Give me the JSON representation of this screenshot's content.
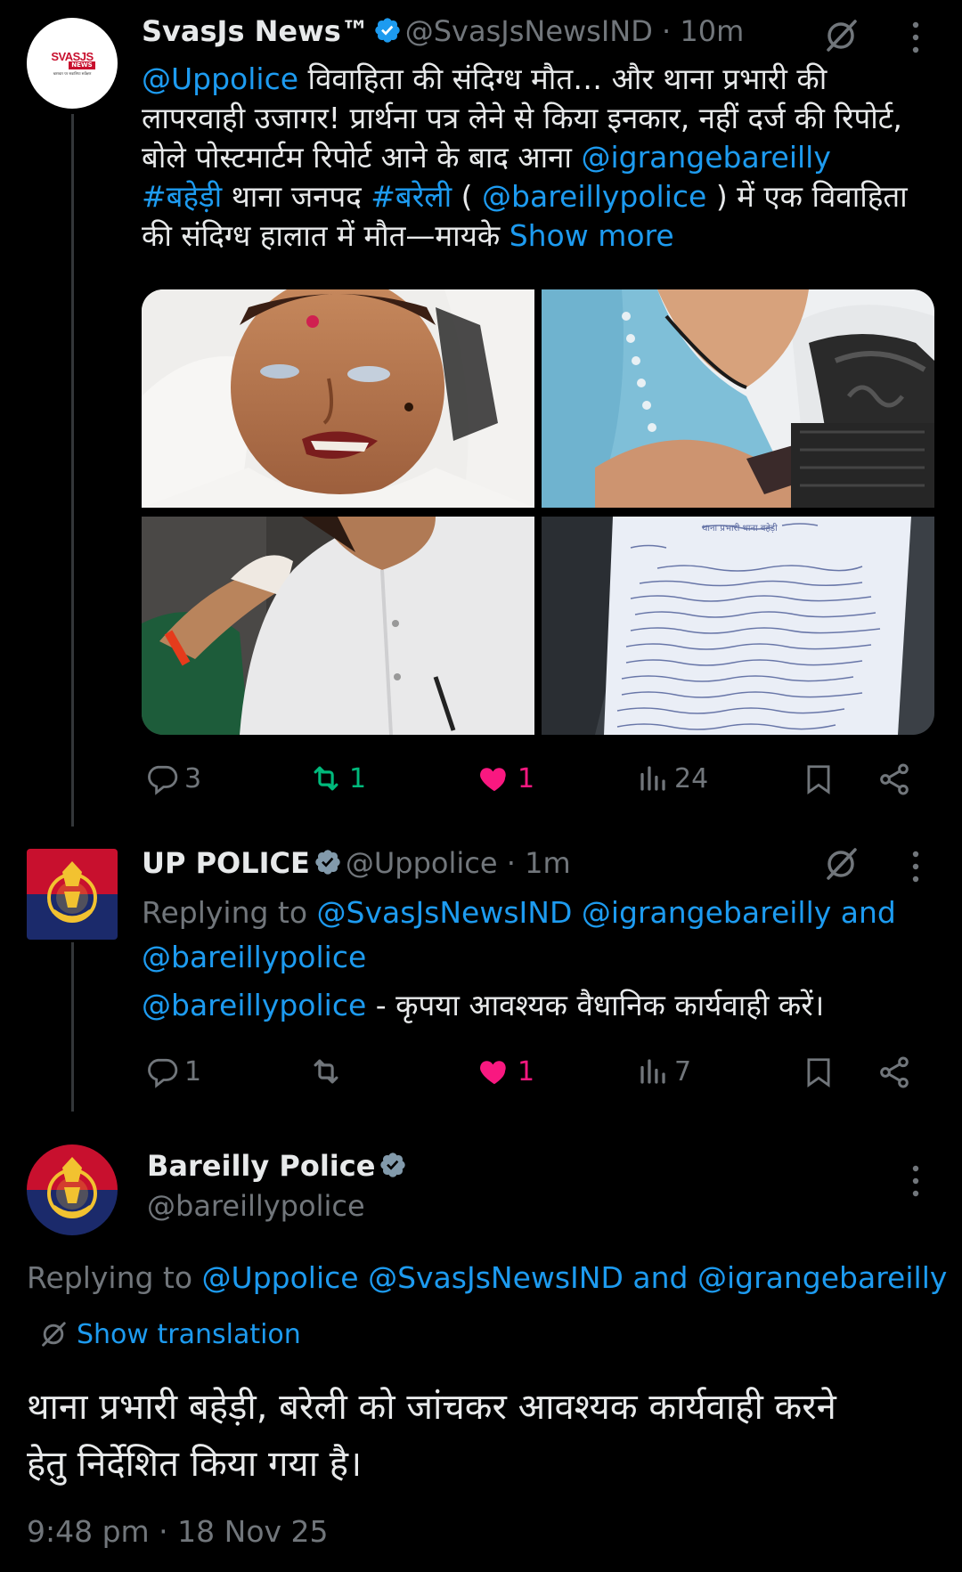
{
  "tweet1": {
    "name": "SvasJs News™",
    "handle": "@SvasJsNewsIND",
    "time": "10m",
    "avatar_text": "SVASJS",
    "avatar_news": "NEWS",
    "avatar_tagline": "भ्रष्टाचार पर सवालिया सर्वेक्षण",
    "text": {
      "l1_mention": "@Uppolice",
      "l1_text": " विवाहिता की संदिग्ध मौत… और थाना प्रभारी की",
      "l2_text": "लापरवाही उजागर! प्रार्थना पत्र लेने से किया इनकार, नहीं दर्ज की रिपोर्ट,",
      "l3_text": "बोले पोस्टमार्टम रिपोर्ट आने के बाद आना ",
      "l3_mention": "@igrangebareilly",
      "l4_hashtag1": "#बहेड़ी",
      "l4_text1": " थाना जनपद ",
      "l4_hashtag2": "#बरेली",
      "l4_text2": " ( ",
      "l4_mention": "@bareillypolice",
      "l4_text3": " ) में एक विवाहिता",
      "l5_text": "की संदिग्ध हालात में मौत—मायके ",
      "l5_more": "Show more"
    },
    "note_header": "थाना प्रभारी थाना बहेड़ी",
    "actions": {
      "replies": "3",
      "reposts": "1",
      "likes": "1",
      "views": "24"
    }
  },
  "tweet2": {
    "name": "UP POLICE",
    "handle": "@Uppolice",
    "time": "1m",
    "replying_prefix": "Replying to ",
    "replying_m1": "@SvasJsNewsIND",
    "replying_m2": " @igrangebareilly",
    "replying_and": " and",
    "replying_m3": "@bareillypolice",
    "body_mention": "@bareillypolice",
    "body_text": " - कृपया आवश्यक वैधानिक कार्यवाही करें।",
    "actions": {
      "replies": "1",
      "reposts": "",
      "likes": "1",
      "views": "7"
    }
  },
  "tweet3": {
    "name": "Bareilly Police",
    "handle": "@bareillypolice",
    "replying_prefix": "Replying to ",
    "replying_m1": "@Uppolice",
    "replying_m2": " @SvasJsNewsIND",
    "replying_and": " and ",
    "replying_m3": "@igrangebareilly",
    "translate_label": "Show translation",
    "text_l1": "थाना प्रभारी बहेड़ी, बरेली को जांचकर आवश्यक कार्यवाही करने",
    "text_l2": "हेतु निर्देशित किया गया है।",
    "timestamp": "9:48 pm · 18 Nov 25"
  },
  "colors": {
    "background": "#000000",
    "link": "#1d9bf0",
    "muted": "#71767b",
    "repost_green": "#00ba7c",
    "like_pink": "#f91880",
    "police_red": "#c8102e",
    "police_navy": "#1b2a6b"
  },
  "icons": [
    "verified-badge-icon",
    "grok-icon",
    "more-icon",
    "reply-icon",
    "repost-icon",
    "like-icon",
    "views-icon",
    "bookmark-icon",
    "share-icon",
    "translate-icon",
    "police-emblem-icon"
  ]
}
